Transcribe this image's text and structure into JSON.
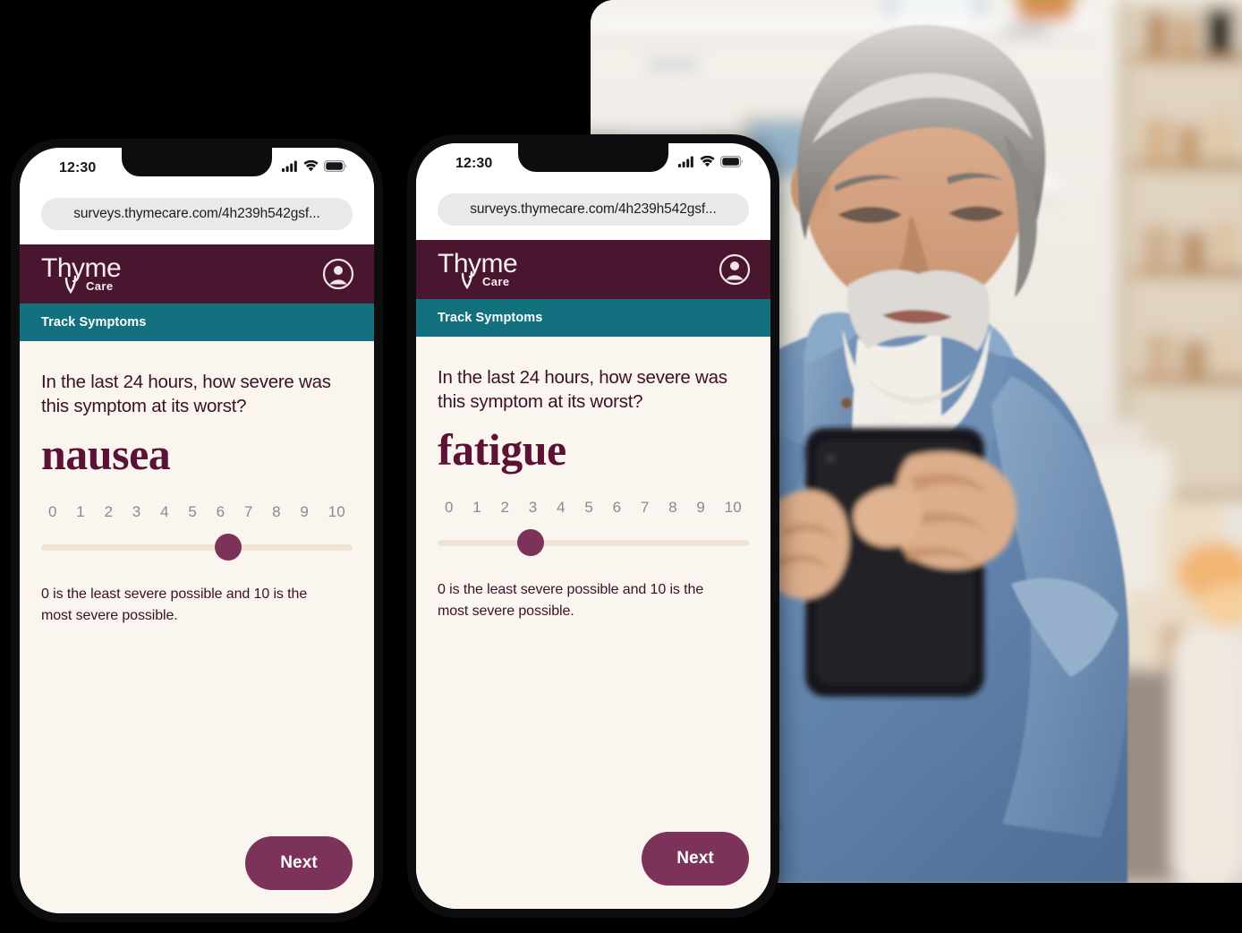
{
  "background_color": "#000000",
  "colors": {
    "brand_maroon": "#4A152F",
    "section_teal": "#13717F",
    "content_cream": "#FAF6EF",
    "accent_purple": "#7D3259",
    "slider_track": "#EFE4D3",
    "symptom_text": "#5B1235",
    "scale_label": "#8D8790"
  },
  "phones": [
    {
      "status_bar": {
        "time": "12:30",
        "signal_icon": "cellular-signal-icon",
        "wifi_icon": "wifi-icon",
        "battery_icon": "battery-icon"
      },
      "browser": {
        "url": "surveys.thymecare.com/4h239h542gsf..."
      },
      "brand_bar": {
        "logo_primary": "Thyme",
        "logo_secondary": "Care",
        "account_icon": "account-circle-icon"
      },
      "section_bar": {
        "title": "Track Symptoms"
      },
      "survey": {
        "question": "In the last 24 hours, how severe was this symptom at its worst?",
        "symptom": "nausea",
        "scale_labels": [
          "0",
          "1",
          "2",
          "3",
          "4",
          "5",
          "6",
          "7",
          "8",
          "9",
          "10"
        ],
        "scale_min": 0,
        "scale_max": 10,
        "selected_value": 6,
        "helper_text": "0 is the least severe possible and 10 is the most severe possible."
      },
      "next_button": {
        "label": "Next"
      }
    },
    {
      "status_bar": {
        "time": "12:30",
        "signal_icon": "cellular-signal-icon",
        "wifi_icon": "wifi-icon",
        "battery_icon": "battery-icon"
      },
      "browser": {
        "url": "surveys.thymecare.com/4h239h542gsf..."
      },
      "brand_bar": {
        "logo_primary": "Thyme",
        "logo_secondary": "Care",
        "account_icon": "account-circle-icon"
      },
      "section_bar": {
        "title": "Track Symptoms"
      },
      "survey": {
        "question": "In the last 24 hours, how severe was this symptom at its worst?",
        "symptom": "fatigue",
        "scale_labels": [
          "0",
          "1",
          "2",
          "3",
          "4",
          "5",
          "6",
          "7",
          "8",
          "9",
          "10"
        ],
        "scale_min": 0,
        "scale_max": 10,
        "selected_value": 3,
        "helper_text": "0 is the least severe possible and 10 is the most severe possible."
      },
      "next_button": {
        "label": "Next"
      }
    }
  ],
  "photo": {
    "alt": "Older man with gray hair and beard in a blue denim shirt sitting on a couch looking at a smartphone in a bright home interior with shelves"
  }
}
